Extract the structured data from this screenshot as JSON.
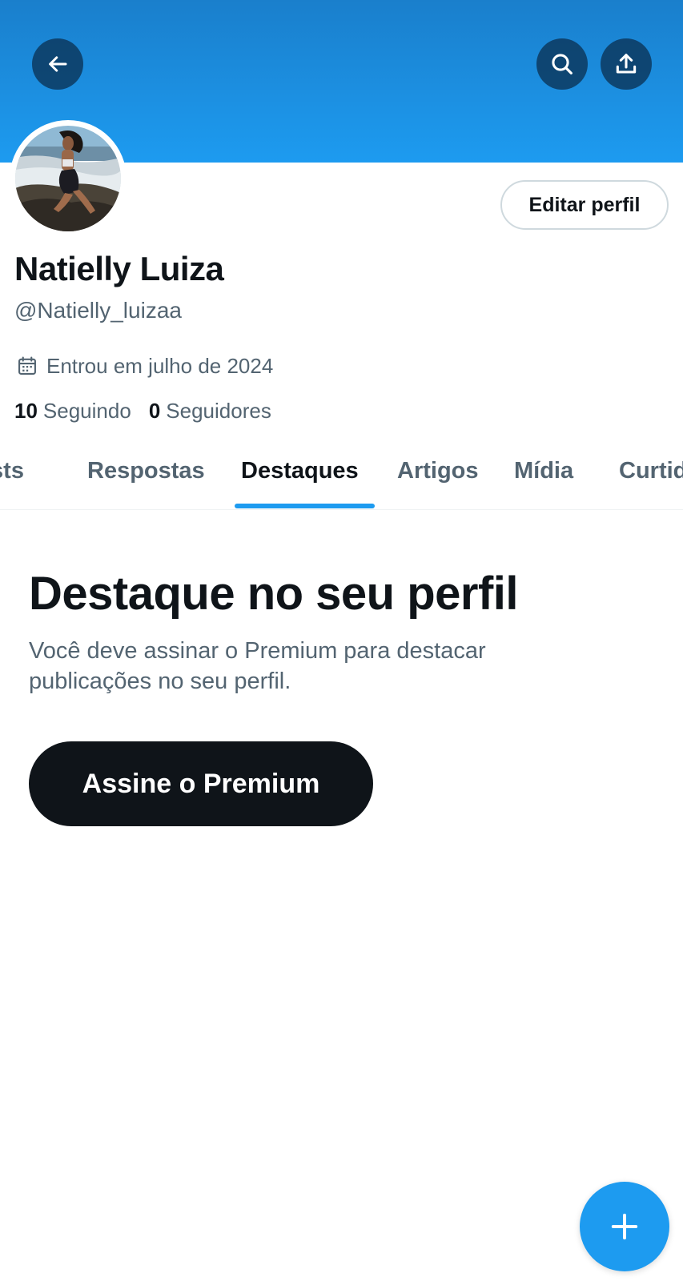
{
  "colors": {
    "accent": "#1d9bf0",
    "banner": "#1d9bf0",
    "text_primary": "#0f1419",
    "text_secondary": "#536471",
    "premium_button": "#0f1419"
  },
  "header": {
    "back_icon": "arrow-left-icon",
    "search_icon": "search-icon",
    "share_icon": "share-upload-icon"
  },
  "profile": {
    "display_name": "Natielly Luiza",
    "handle": "@Natielly_luizaa",
    "joined_icon": "calendar-icon",
    "joined": "Entrou em julho de 2024",
    "following_count": "10",
    "following_label": "Seguindo",
    "followers_count": "0",
    "followers_label": "Seguidores",
    "edit_button": "Editar perfil"
  },
  "tabs": [
    {
      "label": "Posts",
      "active": false
    },
    {
      "label": "Respostas",
      "active": false
    },
    {
      "label": "Destaques",
      "active": true
    },
    {
      "label": "Artigos",
      "active": false
    },
    {
      "label": "Mídia",
      "active": false
    },
    {
      "label": "Curtidas",
      "active": false
    }
  ],
  "promo": {
    "title": "Destaque no seu perfil",
    "text": "Você deve assinar o Premium para destacar publicações no seu perfil.",
    "button": "Assine o Premium"
  },
  "fab": {
    "icon": "plus-icon"
  }
}
